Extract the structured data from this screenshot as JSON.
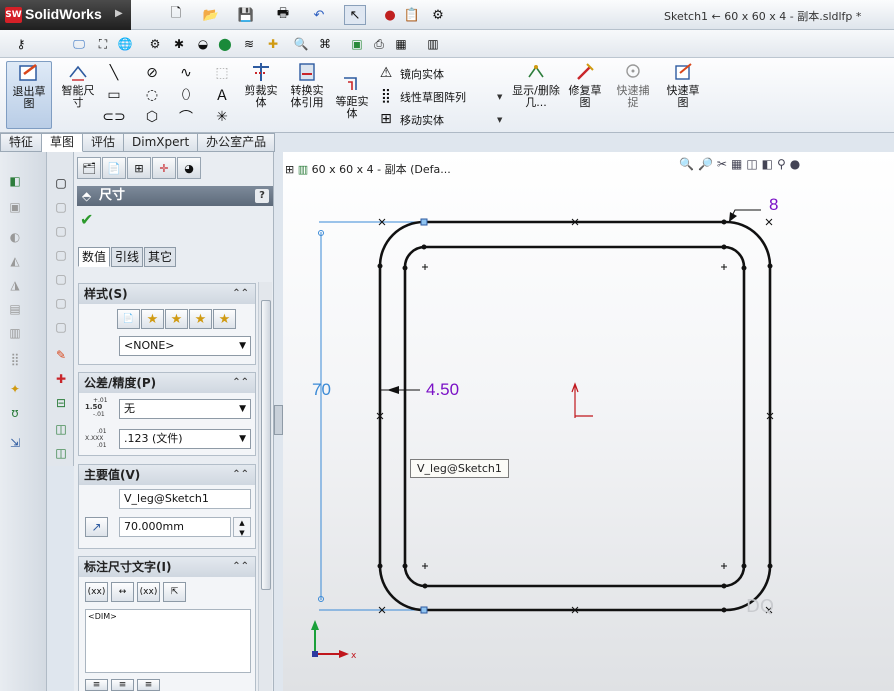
{
  "app": {
    "name": "SolidWorks",
    "logo": "SW"
  },
  "document_title": "Sketch1 ← 60 x 60 x 4 - 副本.sldlfp *",
  "command_manager": {
    "exit_sketch": "退出草图",
    "smart_dim": "智能尺寸",
    "trim": "剪裁实体",
    "convert": "转换实体引用",
    "offset": "等距实体",
    "mirror": "镜向实体",
    "linear_pattern": "线性草图阵列",
    "move": "移动实体",
    "display_delete": "显示/删除几...",
    "repair": "修复草图",
    "quick_snap": "快速捕捉",
    "rapid_sketch": "快速草图"
  },
  "tabs": [
    "特征",
    "草图",
    "评估",
    "DimXpert",
    "办公室产品"
  ],
  "active_tab": 1,
  "tree_root": "60 x 60 x 4 - 副本  (Defa...",
  "pm": {
    "title": "尺寸",
    "help": "?",
    "sub_tabs": [
      "数值",
      "引线",
      "其它"
    ],
    "style": {
      "header": "样式(S)",
      "select": "<NONE>"
    },
    "tolerance": {
      "header": "公差/精度(P)",
      "tol_select": "无",
      "prec_select": ".123 (文件)",
      "tol_icon_top": "+.01",
      "tol_icon_mid": "1.50",
      "tol_icon_bot": "-.01",
      "prec_icon_top": ".01",
      "prec_icon_mid": "X.XXX",
      "prec_icon_bot": ".01"
    },
    "primary": {
      "header": "主要值(V)",
      "name": "V_leg@Sketch1",
      "value": "70.000mm"
    },
    "dimtext": {
      "header": "标注尺寸文字(I)",
      "text": "<DIM>"
    }
  },
  "sketch": {
    "dim_70": "70",
    "dim_450": "4.50",
    "dim_8": "8",
    "tooltip": "V_leg@Sketch1",
    "ghost": "DQ",
    "axis_x": "x",
    "axis_y": "y",
    "colors": {
      "dim": "#7a11c6",
      "driven": "#3a8ad6",
      "geometry": "#111111",
      "origin": "#c0161c"
    }
  }
}
